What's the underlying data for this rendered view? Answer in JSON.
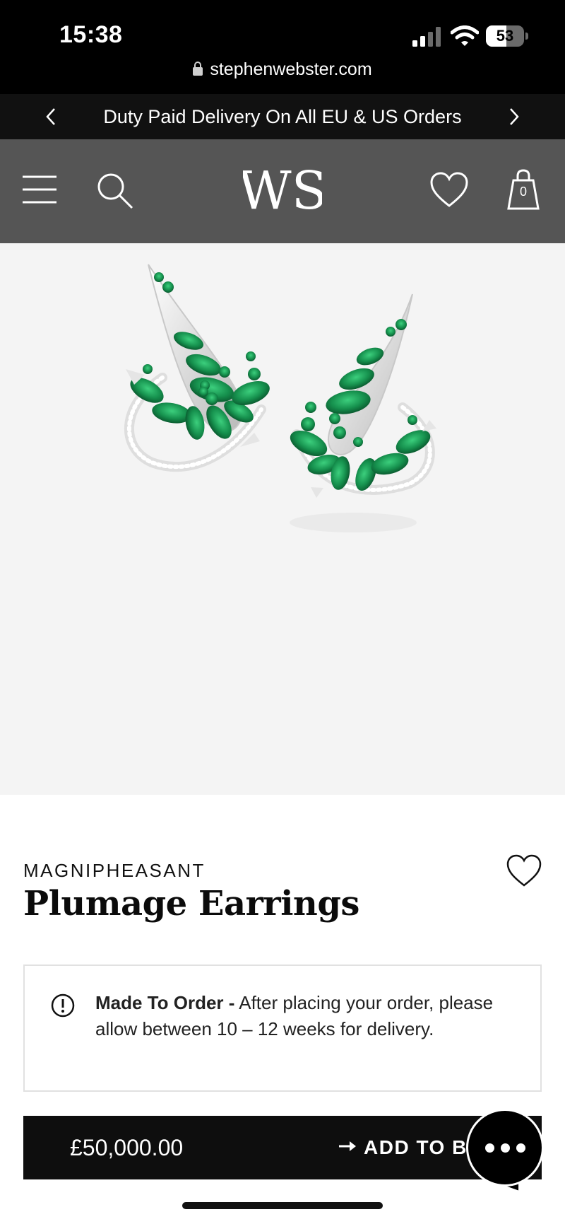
{
  "status_bar": {
    "time": "15:38",
    "battery": "53",
    "battery_level": 0.53,
    "url": "stephenwebster.com",
    "icons": [
      "signal-icon",
      "wifi-icon",
      "battery-icon",
      "lock-icon"
    ]
  },
  "promo": {
    "text": "Duty Paid Delivery On All EU & US Orders",
    "icons": [
      "chevron-left-icon",
      "chevron-right-icon"
    ]
  },
  "header": {
    "icons": [
      "menu-icon",
      "search-icon",
      "logo",
      "heart-icon",
      "bag-icon"
    ],
    "bag_count": "0",
    "logo_text": "WS"
  },
  "product": {
    "collection": "MAGNIPHEASANT",
    "title": "Plumage Earrings",
    "notice_label": "Made To Order -",
    "notice_text": " After placing your order, please allow between 10 – 12 weeks for delivery.",
    "price": "£50,000.00",
    "add_to_bag": "ADD TO BAG"
  },
  "colors": {
    "header_bg": "#555555",
    "banner_bg": "#111111",
    "image_bg": "#f4f4f4",
    "emerald": "#1a9a55",
    "button_bg": "#0e0e0e"
  }
}
